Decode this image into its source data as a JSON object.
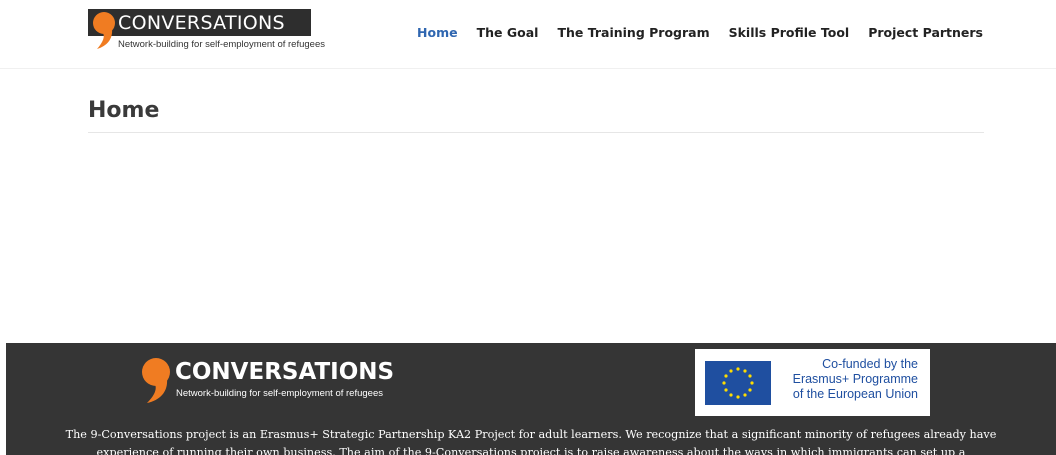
{
  "header": {
    "logo": {
      "title": "CONVERSATIONS",
      "subtitle": "Network-building for self-employment of refugees",
      "comma_icon": "orange-comma-icon"
    },
    "nav": [
      {
        "label": "Home",
        "active": true
      },
      {
        "label": "The Goal",
        "active": false
      },
      {
        "label": "The Training Program",
        "active": false
      },
      {
        "label": "Skills Profile Tool",
        "active": false
      },
      {
        "label": "Project Partners",
        "active": false
      }
    ]
  },
  "main": {
    "title": "Home"
  },
  "footer": {
    "logo": {
      "title": "CONVERSATIONS",
      "subtitle": "Network-building for self-employment of refugees"
    },
    "eu": {
      "line1": "Co-funded by the",
      "line2": "Erasmus+ Programme",
      "line3": "of the European Union",
      "flag_icon": "eu-flag-icon"
    },
    "description": "The 9-Conversations project is an Erasmus+ Strategic Partnership KA2 Project for adult learners. We recognize that a significant minority of refugees already have experience of running their own business. The aim of the 9-Conversations project is to raise awareness about the ways in which immigrants can set up a"
  },
  "colors": {
    "accent_orange": "#f07c22",
    "nav_active": "#2f66b0",
    "footer_bg": "#353535",
    "eu_blue": "#1f4fa0"
  }
}
